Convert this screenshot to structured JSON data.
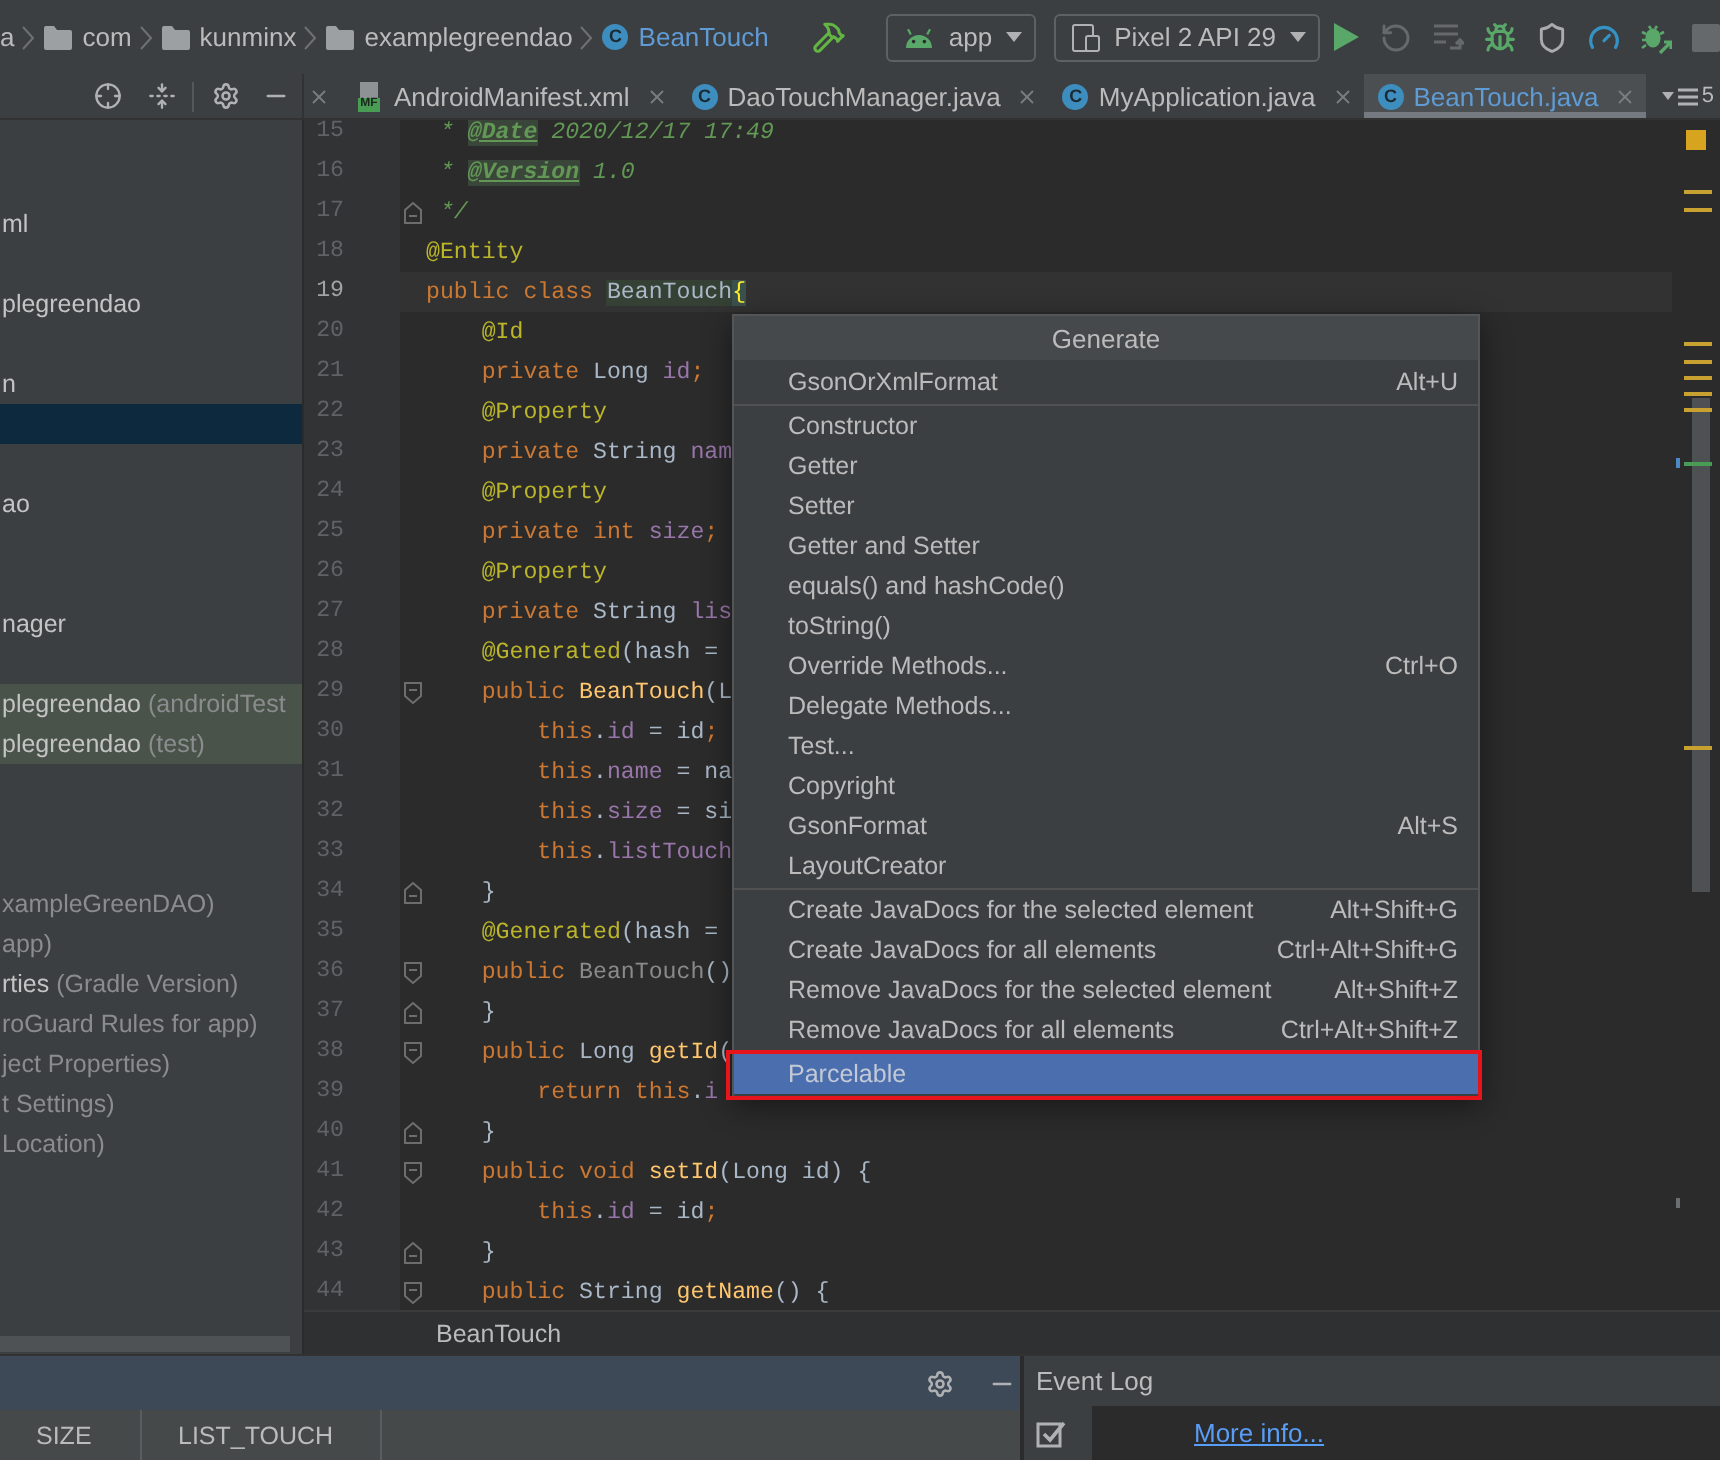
{
  "navbar": {
    "breadcrumbs": [
      {
        "label": "a",
        "kind": "plain",
        "modified": false
      },
      {
        "label": "com",
        "kind": "folder",
        "modified": false
      },
      {
        "label": "kunminx",
        "kind": "folder",
        "modified": false
      },
      {
        "label": "examplegreendao",
        "kind": "folder",
        "modified": false
      },
      {
        "label": "BeanTouch",
        "kind": "class",
        "icon_text": "C",
        "modified": true
      }
    ],
    "run_config": "app",
    "device": "Pixel 2 API 29",
    "actions": [
      {
        "kind": "run",
        "disabled": false
      },
      {
        "kind": "apply_changes",
        "disabled": true
      },
      {
        "kind": "apply_code_changes",
        "disabled": true
      },
      {
        "kind": "debug",
        "disabled": false
      },
      {
        "kind": "coverage",
        "disabled": false
      },
      {
        "kind": "profile",
        "disabled": false
      },
      {
        "kind": "attach_debugger",
        "disabled": false
      },
      {
        "kind": "stop",
        "disabled": true
      }
    ]
  },
  "tabs": {
    "leading_close": true,
    "items": [
      {
        "label": "AndroidManifest.xml",
        "kind": "manifest",
        "icon_text": "MF",
        "selected": false,
        "modified": false
      },
      {
        "label": "DaoTouchManager.java",
        "kind": "class",
        "icon_text": "C",
        "selected": false,
        "modified": false
      },
      {
        "label": "MyApplication.java",
        "kind": "class",
        "icon_text": "C",
        "selected": false,
        "modified": false
      },
      {
        "label": "BeanTouch.java",
        "kind": "class",
        "icon_text": "C",
        "selected": true,
        "modified": true
      }
    ],
    "count": "5"
  },
  "project_tree": [
    {
      "kind": "plain",
      "selected": false
    },
    {
      "kind": "plain",
      "selected": false
    },
    {
      "kind": "plain",
      "selected": false,
      "name": "ml"
    },
    {
      "kind": "plain",
      "selected": false
    },
    {
      "kind": "plain",
      "selected": false,
      "name": "plegreendao"
    },
    {
      "kind": "plain",
      "selected": false
    },
    {
      "kind": "plain",
      "selected": false,
      "name": "n"
    },
    {
      "kind": "plain",
      "selected": true
    },
    {
      "kind": "plain",
      "selected": false
    },
    {
      "kind": "plain",
      "selected": false,
      "name": "ao"
    },
    {
      "kind": "plain",
      "selected": false
    },
    {
      "kind": "plain",
      "selected": false
    },
    {
      "kind": "plain",
      "selected": false,
      "name": "nager"
    },
    {
      "kind": "plain",
      "selected": false
    },
    {
      "kind": "test",
      "selected": false,
      "name": "plegreendao",
      "hint": "(androidTest"
    },
    {
      "kind": "test",
      "selected": false,
      "name": "plegreendao",
      "hint": "(test)"
    },
    {
      "kind": "plain",
      "selected": false
    },
    {
      "kind": "plain",
      "selected": false
    },
    {
      "kind": "plain",
      "selected": false
    },
    {
      "kind": "plain",
      "selected": false,
      "hint": "xampleGreenDAO)"
    },
    {
      "kind": "plain",
      "selected": false,
      "hint": "app)"
    },
    {
      "kind": "plain",
      "selected": false,
      "name": "rties",
      "hint": "(Gradle Version)"
    },
    {
      "kind": "plain",
      "selected": false,
      "hint": "roGuard Rules for app)"
    },
    {
      "kind": "plain",
      "selected": false,
      "hint": "ject Properties)"
    },
    {
      "kind": "plain",
      "selected": false,
      "hint": "t Settings)"
    },
    {
      "kind": "plain",
      "selected": false,
      "hint": "Location)"
    }
  ],
  "editor": {
    "lines": [
      {
        "number": "15",
        "current": false,
        "tokens": [
          {
            "text": " * ",
            "kind": "comment"
          },
          {
            "text": "@Date",
            "kind": "doctag"
          },
          {
            "text": " 2020/12/17 17:49",
            "kind": "comment"
          }
        ]
      },
      {
        "number": "16",
        "current": false,
        "tokens": [
          {
            "text": " * ",
            "kind": "comment"
          },
          {
            "text": "@Version",
            "kind": "doctag"
          },
          {
            "text": " 1.0",
            "kind": "comment"
          }
        ]
      },
      {
        "number": "17",
        "current": false,
        "fold": {
          "kind": "end"
        },
        "tokens": [
          {
            "text": " */",
            "kind": "comment"
          }
        ]
      },
      {
        "number": "18",
        "current": false,
        "tokens": [
          {
            "text": "@Entity",
            "kind": "annotation"
          }
        ]
      },
      {
        "number": "19",
        "current": true,
        "tokens": [
          {
            "text": "public class ",
            "kind": "keyword"
          },
          {
            "text": "BeanTouch",
            "kind": "caret_ident"
          },
          {
            "text": "{",
            "kind": "brace_match"
          }
        ]
      },
      {
        "number": "20",
        "current": false,
        "tokens": [
          {
            "text": "    @Id",
            "kind": "annotation"
          }
        ]
      },
      {
        "number": "21",
        "current": false,
        "tokens": [
          {
            "text": "    private ",
            "kind": "keyword"
          },
          {
            "text": "Long ",
            "kind": "plain"
          },
          {
            "text": "id",
            "kind": "field"
          },
          {
            "text": ";",
            "kind": "keyword"
          }
        ]
      },
      {
        "number": "22",
        "current": false,
        "tokens": [
          {
            "text": "    @Property",
            "kind": "annotation"
          }
        ]
      },
      {
        "number": "23",
        "current": false,
        "tokens": [
          {
            "text": "    private ",
            "kind": "keyword"
          },
          {
            "text": "String ",
            "kind": "plain"
          },
          {
            "text": "nam",
            "kind": "field"
          }
        ]
      },
      {
        "number": "24",
        "current": false,
        "tokens": [
          {
            "text": "    @Property",
            "kind": "annotation"
          }
        ]
      },
      {
        "number": "25",
        "current": false,
        "tokens": [
          {
            "text": "    private int ",
            "kind": "keyword"
          },
          {
            "text": "size",
            "kind": "field"
          },
          {
            "text": ";",
            "kind": "keyword"
          }
        ]
      },
      {
        "number": "26",
        "current": false,
        "tokens": [
          {
            "text": "    @Property",
            "kind": "annotation"
          }
        ]
      },
      {
        "number": "27",
        "current": false,
        "tokens": [
          {
            "text": "    private ",
            "kind": "keyword"
          },
          {
            "text": "String ",
            "kind": "plain"
          },
          {
            "text": "lis",
            "kind": "field"
          }
        ]
      },
      {
        "number": "28",
        "current": false,
        "tokens": [
          {
            "text": "    @Generated",
            "kind": "annotation"
          },
          {
            "text": "(hash =",
            "kind": "plain"
          }
        ]
      },
      {
        "number": "29",
        "current": false,
        "fold": {
          "kind": "start"
        },
        "tokens": [
          {
            "text": "    public ",
            "kind": "keyword"
          },
          {
            "text": "BeanTouch",
            "kind": "method"
          },
          {
            "text": "(L",
            "kind": "plain"
          }
        ]
      },
      {
        "number": "30",
        "current": false,
        "tokens": [
          {
            "text": "        this",
            "kind": "keyword"
          },
          {
            "text": ".",
            "kind": "plain"
          },
          {
            "text": "id",
            "kind": "field"
          },
          {
            "text": " = id",
            "kind": "plain"
          },
          {
            "text": ";",
            "kind": "keyword"
          }
        ]
      },
      {
        "number": "31",
        "current": false,
        "tokens": [
          {
            "text": "        this",
            "kind": "keyword"
          },
          {
            "text": ".",
            "kind": "plain"
          },
          {
            "text": "name",
            "kind": "field"
          },
          {
            "text": " = na",
            "kind": "plain"
          }
        ]
      },
      {
        "number": "32",
        "current": false,
        "tokens": [
          {
            "text": "        this",
            "kind": "keyword"
          },
          {
            "text": ".",
            "kind": "plain"
          },
          {
            "text": "size",
            "kind": "field"
          },
          {
            "text": " = si",
            "kind": "plain"
          }
        ]
      },
      {
        "number": "33",
        "current": false,
        "tokens": [
          {
            "text": "        this",
            "kind": "keyword"
          },
          {
            "text": ".",
            "kind": "plain"
          },
          {
            "text": "listTouch",
            "kind": "field"
          }
        ]
      },
      {
        "number": "34",
        "current": false,
        "fold": {
          "kind": "end"
        },
        "tokens": [
          {
            "text": "    }",
            "kind": "plain"
          }
        ]
      },
      {
        "number": "35",
        "current": false,
        "tokens": [
          {
            "text": "    @Generated",
            "kind": "annotation"
          },
          {
            "text": "(hash =",
            "kind": "plain"
          }
        ]
      },
      {
        "number": "36",
        "current": false,
        "fold": {
          "kind": "start"
        },
        "tokens": [
          {
            "text": "    public ",
            "kind": "keyword"
          },
          {
            "text": "BeanTouch",
            "kind": "unused"
          },
          {
            "text": "()",
            "kind": "plain"
          }
        ]
      },
      {
        "number": "37",
        "current": false,
        "fold": {
          "kind": "end"
        },
        "tokens": [
          {
            "text": "    }",
            "kind": "plain"
          }
        ]
      },
      {
        "number": "38",
        "current": false,
        "fold": {
          "kind": "start"
        },
        "tokens": [
          {
            "text": "    public ",
            "kind": "keyword"
          },
          {
            "text": "Long ",
            "kind": "plain"
          },
          {
            "text": "getId",
            "kind": "method"
          },
          {
            "text": "(",
            "kind": "plain"
          }
        ]
      },
      {
        "number": "39",
        "current": false,
        "tokens": [
          {
            "text": "        return this",
            "kind": "keyword"
          },
          {
            "text": ".",
            "kind": "plain"
          },
          {
            "text": "i",
            "kind": "field"
          }
        ]
      },
      {
        "number": "40",
        "current": false,
        "fold": {
          "kind": "end"
        },
        "tokens": [
          {
            "text": "    }",
            "kind": "plain"
          }
        ]
      },
      {
        "number": "41",
        "current": false,
        "fold": {
          "kind": "start"
        },
        "tokens": [
          {
            "text": "    public void ",
            "kind": "keyword"
          },
          {
            "text": "setId",
            "kind": "method"
          },
          {
            "text": "(Long id) {",
            "kind": "plain"
          }
        ]
      },
      {
        "number": "42",
        "current": false,
        "tokens": [
          {
            "text": "        this",
            "kind": "keyword"
          },
          {
            "text": ".",
            "kind": "plain"
          },
          {
            "text": "id",
            "kind": "field"
          },
          {
            "text": " = id",
            "kind": "plain"
          },
          {
            "text": ";",
            "kind": "keyword"
          }
        ]
      },
      {
        "number": "43",
        "current": false,
        "fold": {
          "kind": "end"
        },
        "tokens": [
          {
            "text": "    }",
            "kind": "plain"
          }
        ]
      },
      {
        "number": "44",
        "current": false,
        "fold": {
          "kind": "start"
        },
        "tokens": [
          {
            "text": "    public ",
            "kind": "keyword"
          },
          {
            "text": "String ",
            "kind": "plain"
          },
          {
            "text": "getName",
            "kind": "method"
          },
          {
            "text": "() {",
            "kind": "plain"
          }
        ]
      }
    ],
    "breadcrumb": "BeanTouch"
  },
  "generate_menu": {
    "title": "Generate",
    "sections": [
      {
        "items": [
          {
            "label": "GsonOrXmlFormat",
            "shortcut": "Alt+U",
            "selected": false,
            "outlined": false
          }
        ]
      },
      {
        "items": [
          {
            "label": "Constructor",
            "selected": false,
            "outlined": false
          },
          {
            "label": "Getter",
            "selected": false,
            "outlined": false
          },
          {
            "label": "Setter",
            "selected": false,
            "outlined": false
          },
          {
            "label": "Getter and Setter",
            "selected": false,
            "outlined": false
          },
          {
            "label": "equals() and hashCode()",
            "selected": false,
            "outlined": false
          },
          {
            "label": "toString()",
            "selected": false,
            "outlined": false
          },
          {
            "label": "Override Methods...",
            "shortcut": "Ctrl+O",
            "selected": false,
            "outlined": false
          },
          {
            "label": "Delegate Methods...",
            "selected": false,
            "outlined": false
          },
          {
            "label": "Test...",
            "selected": false,
            "outlined": false
          },
          {
            "label": "Copyright",
            "selected": false,
            "outlined": false
          },
          {
            "label": "GsonFormat",
            "shortcut": "Alt+S",
            "selected": false,
            "outlined": false
          },
          {
            "label": "LayoutCreator",
            "selected": false,
            "outlined": false
          }
        ]
      },
      {
        "items": [
          {
            "label": "Create JavaDocs for the selected element",
            "shortcut": "Alt+Shift+G",
            "selected": false,
            "outlined": false
          },
          {
            "label": "Create JavaDocs for all elements",
            "shortcut": "Ctrl+Alt+Shift+G",
            "selected": false,
            "outlined": false
          },
          {
            "label": "Remove JavaDocs for the selected element",
            "shortcut": "Alt+Shift+Z",
            "selected": false,
            "outlined": false
          },
          {
            "label": "Remove JavaDocs for all elements",
            "shortcut": "Ctrl+Alt+Shift+Z",
            "selected": false,
            "outlined": false
          }
        ]
      },
      {
        "items": [
          {
            "label": "Parcelable",
            "selected": true,
            "outlined": true
          }
        ]
      }
    ]
  },
  "bottom_panel": {
    "focused": true,
    "columns": [
      "SIZE",
      "LIST_TOUCH"
    ]
  },
  "event_log": {
    "title": "Event Log",
    "link": "More info..."
  }
}
